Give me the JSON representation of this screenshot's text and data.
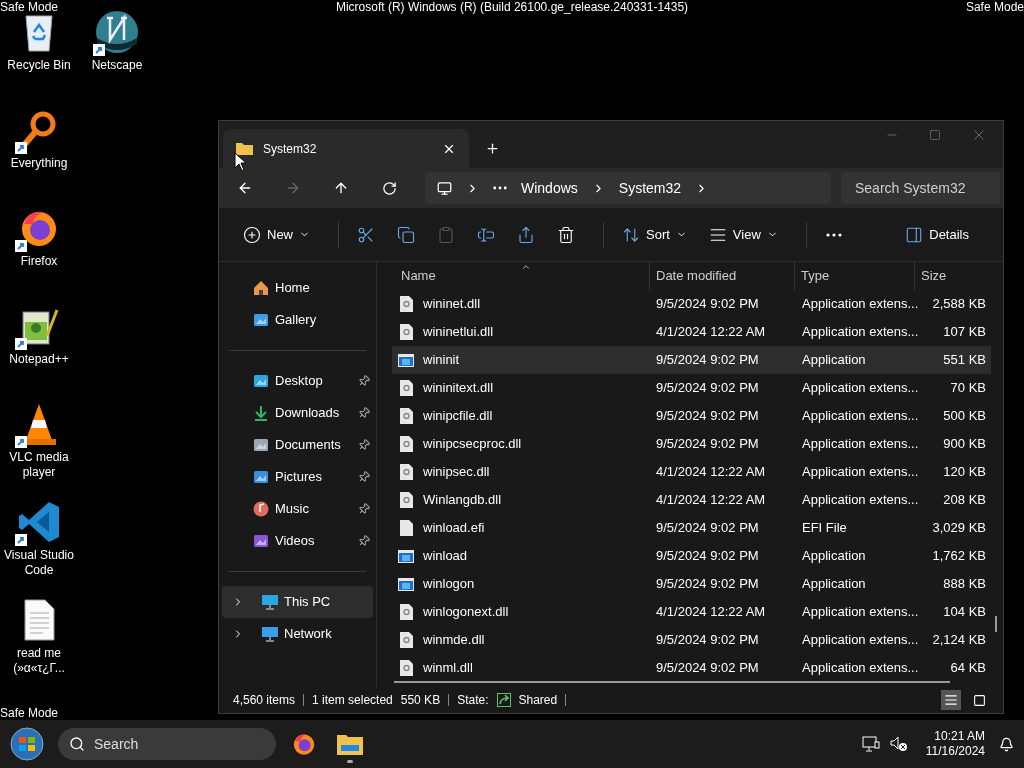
{
  "screen_labels": {
    "top_left": "Safe Mode",
    "title": "Microsoft (R) Windows (R) (Build 26100.ge_release.240331-1435)",
    "top_right": "Safe Mode",
    "bottom_left": "Safe Mode"
  },
  "desktop_icons": [
    {
      "label": "Recycle Bin",
      "kind": "recycle",
      "shortcut": false
    },
    {
      "label": "Netscape",
      "kind": "netscape",
      "shortcut": true
    },
    {
      "label": "Everything",
      "kind": "everything",
      "shortcut": true
    },
    {
      "label": "Firefox",
      "kind": "firefox",
      "shortcut": true
    },
    {
      "label": "Notepad++",
      "kind": "notepad",
      "shortcut": true
    },
    {
      "label": "VLC media player",
      "kind": "vlc",
      "shortcut": true
    },
    {
      "label": "Visual Studio Code",
      "kind": "vscode",
      "shortcut": true
    },
    {
      "label": "read me (»α«τ¿Γ...",
      "kind": "text",
      "shortcut": false
    }
  ],
  "window": {
    "tab": "System32",
    "address": {
      "crumbs": [
        "Windows",
        "System32"
      ]
    },
    "search": {
      "placeholder": "Search System32"
    },
    "toolbar": [
      {
        "kind": "new",
        "label": "New",
        "disabled": false
      },
      {
        "kind": "cut",
        "disabled": false
      },
      {
        "kind": "copy",
        "disabled": false
      },
      {
        "kind": "paste",
        "disabled": true
      },
      {
        "kind": "rename",
        "disabled": false
      },
      {
        "kind": "share",
        "disabled": false
      },
      {
        "kind": "delete",
        "disabled": false
      },
      {
        "kind": "sort",
        "label": "Sort",
        "disabled": false
      },
      {
        "kind": "view",
        "label": "View",
        "disabled": false
      },
      {
        "kind": "more",
        "disabled": false
      },
      {
        "kind": "details",
        "label": "Details",
        "disabled": false
      }
    ],
    "sidebar": {
      "quick": [
        {
          "label": "Home",
          "kind": "home"
        },
        {
          "label": "Gallery",
          "kind": "gallery"
        }
      ],
      "pinned": [
        {
          "label": "Desktop",
          "kind": "desktop",
          "pinned": true
        },
        {
          "label": "Downloads",
          "kind": "downloads",
          "pinned": true
        },
        {
          "label": "Documents",
          "kind": "documents",
          "pinned": true
        },
        {
          "label": "Pictures",
          "kind": "pictures",
          "pinned": true
        },
        {
          "label": "Music",
          "kind": "music",
          "pinned": true
        },
        {
          "label": "Videos",
          "kind": "videos",
          "pinned": true
        }
      ],
      "tree": [
        {
          "label": "This PC",
          "kind": "pc",
          "selected": true,
          "expanded": false
        },
        {
          "label": "Network",
          "kind": "network",
          "selected": false,
          "expanded": false
        }
      ]
    },
    "table": {
      "columns": [
        "Name",
        "Date modified",
        "Type",
        "Size"
      ],
      "rows": [
        {
          "name": "wininet.dll",
          "date": "9/5/2024 9:02 PM",
          "type": "Application extens...",
          "size": "2,588 KB",
          "kind": "dll",
          "selected": false
        },
        {
          "name": "wininetlui.dll",
          "date": "4/1/2024 12:22 AM",
          "type": "Application extens...",
          "size": "107 KB",
          "kind": "dll",
          "selected": false
        },
        {
          "name": "wininit",
          "date": "9/5/2024 9:02 PM",
          "type": "Application",
          "size": "551 KB",
          "kind": "exe",
          "selected": true
        },
        {
          "name": "wininitext.dll",
          "date": "9/5/2024 9:02 PM",
          "type": "Application extens...",
          "size": "70 KB",
          "kind": "dll",
          "selected": false
        },
        {
          "name": "winipcfile.dll",
          "date": "9/5/2024 9:02 PM",
          "type": "Application extens...",
          "size": "500 KB",
          "kind": "dll",
          "selected": false
        },
        {
          "name": "winipcsecproc.dll",
          "date": "9/5/2024 9:02 PM",
          "type": "Application extens...",
          "size": "900 KB",
          "kind": "dll",
          "selected": false
        },
        {
          "name": "winipsec.dll",
          "date": "4/1/2024 12:22 AM",
          "type": "Application extens...",
          "size": "120 KB",
          "kind": "dll",
          "selected": false
        },
        {
          "name": "Winlangdb.dll",
          "date": "4/1/2024 12:22 AM",
          "type": "Application extens...",
          "size": "208 KB",
          "kind": "dll",
          "selected": false
        },
        {
          "name": "winload.efi",
          "date": "9/5/2024 9:02 PM",
          "type": "EFI File",
          "size": "3,029 KB",
          "kind": "file",
          "selected": false
        },
        {
          "name": "winload",
          "date": "9/5/2024 9:02 PM",
          "type": "Application",
          "size": "1,762 KB",
          "kind": "exe",
          "selected": false
        },
        {
          "name": "winlogon",
          "date": "9/5/2024 9:02 PM",
          "type": "Application",
          "size": "888 KB",
          "kind": "exe",
          "selected": false
        },
        {
          "name": "winlogonext.dll",
          "date": "4/1/2024 12:22 AM",
          "type": "Application extens...",
          "size": "104 KB",
          "kind": "dll",
          "selected": false
        },
        {
          "name": "winmde.dll",
          "date": "9/5/2024 9:02 PM",
          "type": "Application extens...",
          "size": "2,124 KB",
          "kind": "dll",
          "selected": false
        },
        {
          "name": "winml.dll",
          "date": "9/5/2024 9:02 PM",
          "type": "Application extens...",
          "size": "64 KB",
          "kind": "dll",
          "selected": false
        }
      ]
    },
    "status_bar": {
      "items": "4,560 items",
      "selection": "1 item selected",
      "selection_size": "550 KB",
      "state_label": "State:",
      "state": "Shared",
      "views": [
        {
          "kind": "details",
          "selected": true
        },
        {
          "kind": "tiles",
          "selected": false
        }
      ]
    }
  },
  "taskbar": {
    "search": {
      "placeholder": "Search"
    },
    "apps": [
      {
        "kind": "firefox",
        "active": false
      },
      {
        "kind": "explorer",
        "active": true
      }
    ],
    "time": "10:21 AM",
    "date": "11/16/2024"
  }
}
